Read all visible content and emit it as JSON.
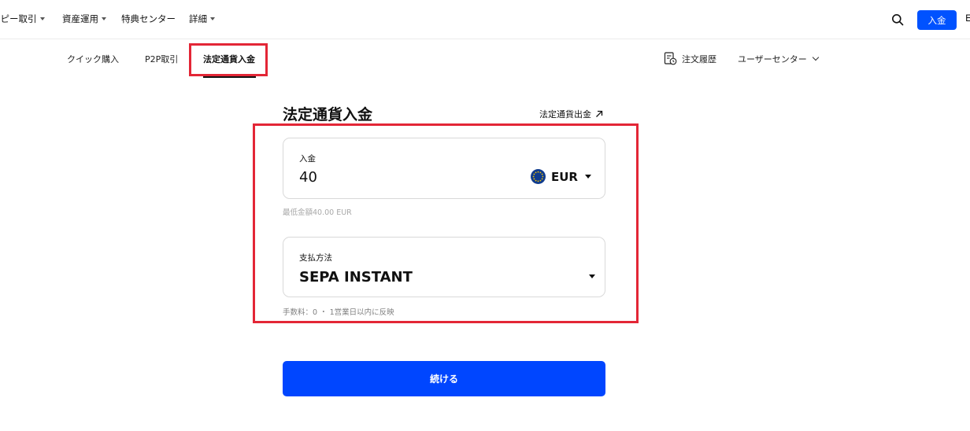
{
  "topnav": {
    "items": [
      {
        "label": "コピー取引",
        "has_caret": true
      },
      {
        "label": "資産運用",
        "has_caret": true
      },
      {
        "label": "特典センター",
        "has_caret": false
      },
      {
        "label": "詳細",
        "has_caret": true
      }
    ],
    "search_icon": "search-icon",
    "deposit_button": "入金",
    "edge_glyph": "E"
  },
  "subnav": {
    "tabs": [
      {
        "label": "クイック購入"
      },
      {
        "label": "P2P取引"
      },
      {
        "label": "法定通貨入金",
        "active": true
      }
    ],
    "order_history": "注文履歴",
    "user_center": "ユーザーセンター"
  },
  "panel": {
    "title": "法定通貨入金",
    "withdraw_link": "法定通貨出金",
    "amount": {
      "label": "入金",
      "value": "40",
      "currency": "EUR",
      "currency_icon": "eu-flag-icon",
      "min_hint": "最低金額40.00 EUR"
    },
    "payment_method": {
      "label": "支払方法",
      "value": "SEPA INSTANT",
      "fee_hint": "手数料：0 ・ 1営業日以内に反映"
    },
    "continue_button": "続ける"
  },
  "colors": {
    "accent": "#0052ff",
    "highlight": "#e32636",
    "border": "#d9d9d9",
    "hint_text": "#a8a8a8"
  }
}
